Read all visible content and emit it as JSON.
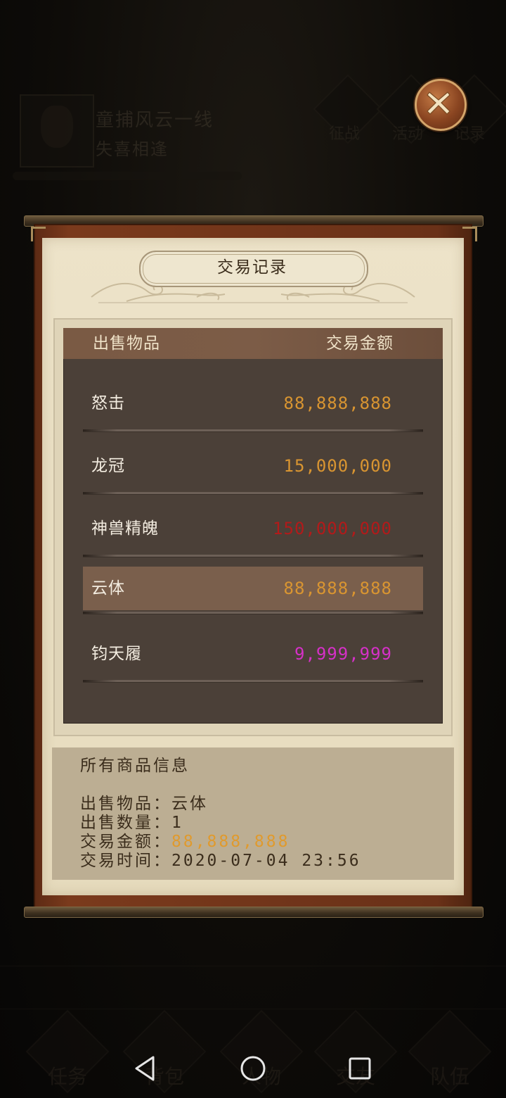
{
  "background": {
    "player_name": "童捕风云一线",
    "player_subtitle": "失喜相逢",
    "top_icon_labels": [
      "征战",
      "活动",
      "记录"
    ],
    "bottom_menu_labels": [
      "任务",
      "背包",
      "人物",
      "交友",
      "队伍"
    ]
  },
  "close_button": {
    "icon": "close-x-icon"
  },
  "panel": {
    "title": "交易记录",
    "header": {
      "item_col": "出售物品",
      "amount_col": "交易金额"
    },
    "rows": [
      {
        "name": "怒击",
        "price": "88,888,888",
        "price_color": "#d99531",
        "selected": false
      },
      {
        "name": "龙冠",
        "price": "15,000,000",
        "price_color": "#d99531",
        "selected": false
      },
      {
        "name": "神兽精魄",
        "price": "150,000,000",
        "price_color": "#b21a1a",
        "selected": false
      },
      {
        "name": "云体",
        "price": "88,888,888",
        "price_color": "#d99531",
        "selected": true
      },
      {
        "name": "钧天履",
        "price": "9,999,999",
        "price_color": "#d630c8",
        "selected": false
      }
    ],
    "info": {
      "title": "所有商品信息",
      "item_label": "出售物品：",
      "item_value": "云体",
      "qty_label": "出售数量：",
      "qty_value": "1",
      "amount_label": "交易金额：",
      "amount_value": "88,888,888",
      "time_label": "交易时间：",
      "time_value": "2020-07-04 23:56"
    }
  },
  "navbar": {
    "back": "back-triangle-icon",
    "home": "home-circle-icon",
    "recents": "recents-square-icon"
  }
}
